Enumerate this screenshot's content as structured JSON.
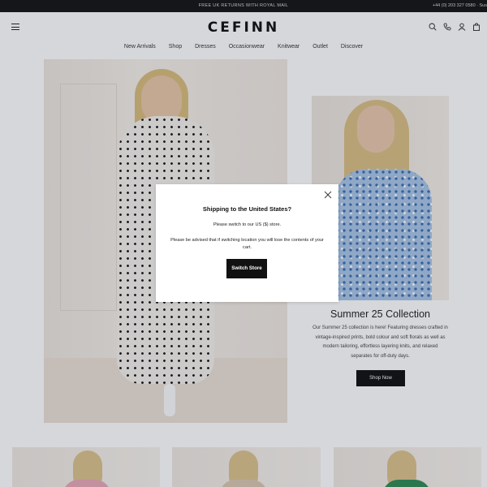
{
  "topbar": {
    "promo": "FREE UK RETURNS WITH ROYAL MAIL",
    "contact": "+44 (0) 203 327 0580 · Sus"
  },
  "header": {
    "logo": "CEFINN",
    "icons": [
      "menu-icon",
      "search-icon",
      "phone-icon",
      "account-icon",
      "bag-icon"
    ]
  },
  "nav": {
    "items": [
      "New Arrivals",
      "Shop",
      "Dresses",
      "Occasionwear",
      "Knitwear",
      "Outlet",
      "Discover"
    ]
  },
  "collection": {
    "title": "Summer 25 Collection",
    "description": "Our Summer 25 collection is here! Featuring dresses crafted in vintage-inspired prints, bold colour and soft florals as well as modern tailoring, effortless layering knits, and relaxed separates for off-duty days.",
    "cta": "Shop Now"
  },
  "modal": {
    "title": "Shipping to the United States?",
    "line1": "Please switch to our US ($) store.",
    "line2": "Please be advised that if switching location you will lose the contents of your cart.",
    "button": "Switch Store",
    "close_icon": "close-icon"
  },
  "colors": {
    "dark": "#111111",
    "overlay": "#1e2230"
  }
}
